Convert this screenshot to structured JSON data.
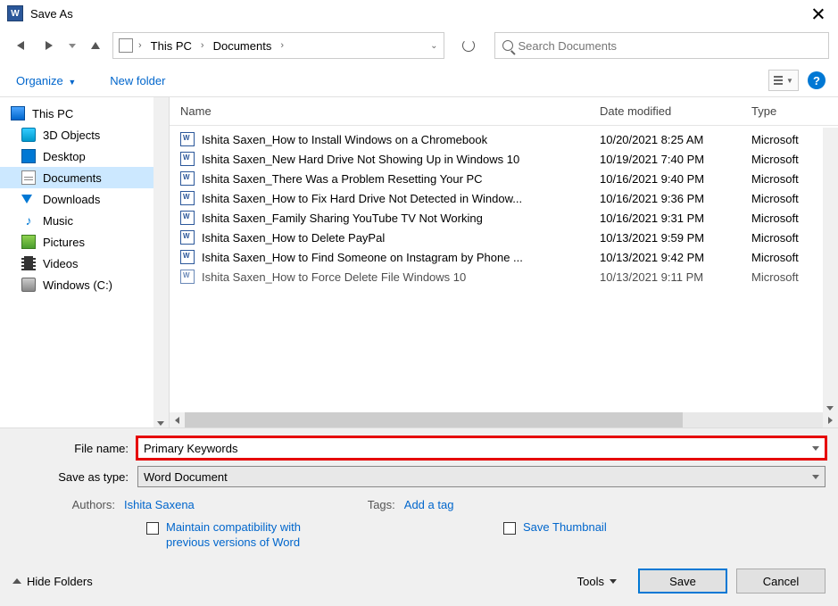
{
  "window": {
    "title": "Save As"
  },
  "breadcrumb": {
    "root": "This PC",
    "folder": "Documents"
  },
  "search": {
    "placeholder": "Search Documents"
  },
  "toolbar": {
    "organize": "Organize",
    "newfolder": "New folder"
  },
  "sidebar": {
    "items": [
      {
        "label": "This PC"
      },
      {
        "label": "3D Objects"
      },
      {
        "label": "Desktop"
      },
      {
        "label": "Documents"
      },
      {
        "label": "Downloads"
      },
      {
        "label": "Music"
      },
      {
        "label": "Pictures"
      },
      {
        "label": "Videos"
      },
      {
        "label": "Windows (C:)"
      }
    ]
  },
  "columns": {
    "name": "Name",
    "date": "Date modified",
    "type": "Type"
  },
  "files": [
    {
      "name": "Ishita Saxen_How to Install Windows on a Chromebook",
      "date": "10/20/2021 8:25 AM",
      "type": "Microsoft"
    },
    {
      "name": "Ishita Saxen_New Hard Drive Not Showing Up in Windows 10",
      "date": "10/19/2021 7:40 PM",
      "type": "Microsoft"
    },
    {
      "name": "Ishita Saxen_There Was a Problem Resetting Your PC",
      "date": "10/16/2021 9:40 PM",
      "type": "Microsoft"
    },
    {
      "name": "Ishita Saxen_How to Fix Hard Drive Not Detected in Window...",
      "date": "10/16/2021 9:36 PM",
      "type": "Microsoft"
    },
    {
      "name": "Ishita Saxen_Family Sharing YouTube TV Not Working",
      "date": "10/16/2021 9:31 PM",
      "type": "Microsoft"
    },
    {
      "name": "Ishita Saxen_How to Delete PayPal",
      "date": "10/13/2021 9:59 PM",
      "type": "Microsoft"
    },
    {
      "name": "Ishita Saxen_How to Find Someone on Instagram by Phone ...",
      "date": "10/13/2021 9:42 PM",
      "type": "Microsoft"
    },
    {
      "name": "Ishita Saxen_How to Force Delete File Windows 10",
      "date": "10/13/2021 9:11 PM",
      "type": "Microsoft"
    }
  ],
  "form": {
    "filename_label": "File name:",
    "filename_value": "Primary Keywords",
    "savetype_label": "Save as type:",
    "savetype_value": "Word Document",
    "authors_label": "Authors:",
    "authors_value": "Ishita Saxena",
    "tags_label": "Tags:",
    "tags_value": "Add a tag",
    "maintain": "Maintain compatibility with previous versions of Word",
    "thumbnail": "Save Thumbnail"
  },
  "footer": {
    "hide": "Hide Folders",
    "tools": "Tools",
    "save": "Save",
    "cancel": "Cancel"
  }
}
